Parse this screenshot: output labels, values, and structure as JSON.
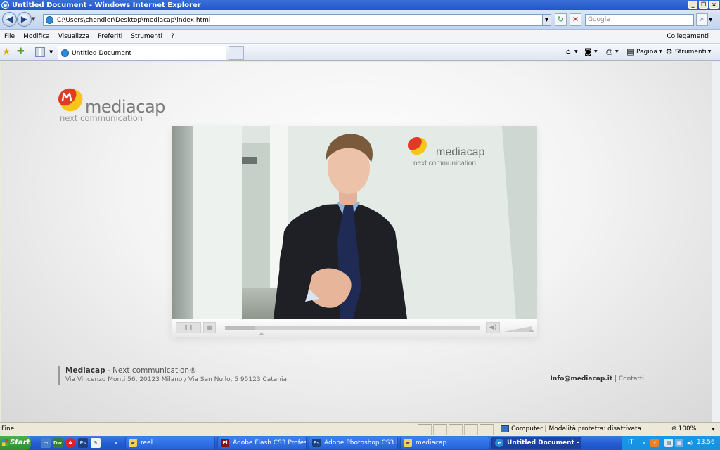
{
  "window": {
    "title": "Untitled Document - Windows Internet Explorer",
    "min": "_",
    "max": "❐",
    "close": "×"
  },
  "address_bar": {
    "url": "C:\\Users\\chendler\\Desktop\\mediacap\\index.html",
    "search_placeholder": "Google"
  },
  "menu": {
    "items": [
      "File",
      "Modifica",
      "Visualizza",
      "Preferiti",
      "Strumenti",
      "?"
    ],
    "links": "Collegamenti"
  },
  "tabs": [
    {
      "label": "Untitled Document",
      "active": true
    }
  ],
  "command_bar": {
    "page": "Pagina",
    "tools": "Strumenti"
  },
  "page": {
    "logo": {
      "name": "mediacap",
      "tagline": "next communication",
      "colors": {
        "red": "#e23a27",
        "yellow": "#f5c51a",
        "gray": "#7b7b7b"
      }
    },
    "player": {
      "pause_icon": "pause-icon",
      "stop_icon": "stop-icon",
      "volume_icon": "speaker-icon",
      "progress": 0.12
    },
    "footer": {
      "company": "Mediacap",
      "tagline": " - Next communication®",
      "address": "Via Vincenzo Monti 56, 20123 Milano / Via San Nullo, 5 95123 Catania",
      "email": "Info@mediacap.it",
      "separator": " | ",
      "contacts": "Contatti"
    }
  },
  "status_bar": {
    "text": "Fine",
    "zone": "Computer | Modalità protetta: disattivata",
    "zoom": "100%"
  },
  "taskbar": {
    "start": "Start",
    "items": [
      {
        "label": "reel"
      },
      {
        "label": "Adobe Flash CS3 Profess..."
      },
      {
        "label": "Adobe Photoshop CS3 E..."
      },
      {
        "label": "mediacap"
      },
      {
        "label": "Untitled Document - ..."
      }
    ],
    "lang": "IT",
    "clock": "13.56"
  }
}
